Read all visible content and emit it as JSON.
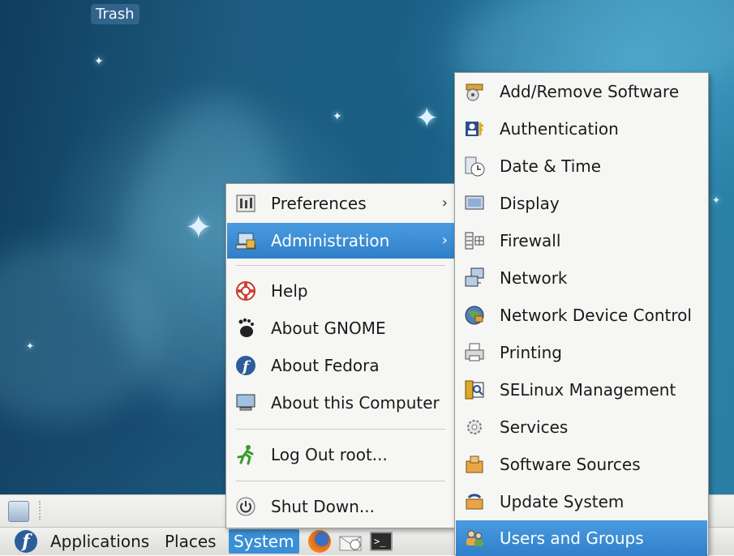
{
  "desktop": {
    "trash_label": "Trash"
  },
  "panel": {
    "menus": [
      "Applications",
      "Places",
      "System"
    ]
  },
  "system_menu": {
    "items": [
      {
        "label": "Preferences",
        "icon": "preferences-icon",
        "submenu": true
      },
      {
        "label": "Administration",
        "icon": "administration-icon",
        "submenu": true,
        "active": true
      },
      {
        "label": "Help",
        "icon": "lifebuoy-icon"
      },
      {
        "label": "About GNOME",
        "icon": "gnome-foot-icon"
      },
      {
        "label": "About Fedora",
        "icon": "fedora-icon"
      },
      {
        "label": "About this Computer",
        "icon": "monitor-icon"
      },
      {
        "label": "Log Out root...",
        "icon": "running-man-icon"
      },
      {
        "label": "Shut Down...",
        "icon": "power-icon"
      }
    ],
    "arrow_glyph": "›"
  },
  "administration_menu": {
    "items": [
      {
        "label": "Add/Remove Software",
        "icon": "package-icon"
      },
      {
        "label": "Authentication",
        "icon": "keys-user-icon"
      },
      {
        "label": "Date & Time",
        "icon": "clock-icon"
      },
      {
        "label": "Display",
        "icon": "display-icon"
      },
      {
        "label": "Firewall",
        "icon": "firewall-icon"
      },
      {
        "label": "Network",
        "icon": "network-icon"
      },
      {
        "label": "Network Device Control",
        "icon": "network-device-icon"
      },
      {
        "label": "Printing",
        "icon": "printer-icon"
      },
      {
        "label": "SELinux Management",
        "icon": "selinux-icon"
      },
      {
        "label": "Services",
        "icon": "gear-icon"
      },
      {
        "label": "Software Sources",
        "icon": "software-sources-icon"
      },
      {
        "label": "Update System",
        "icon": "update-icon"
      },
      {
        "label": "Users and Groups",
        "icon": "users-icon",
        "active": true
      }
    ]
  },
  "launchers": {
    "terminal_glyph": ">_"
  },
  "colors": {
    "accent": "#2f80c9",
    "menu_bg": "#f6f6f4",
    "panel_bg": "#e6e6e4"
  }
}
